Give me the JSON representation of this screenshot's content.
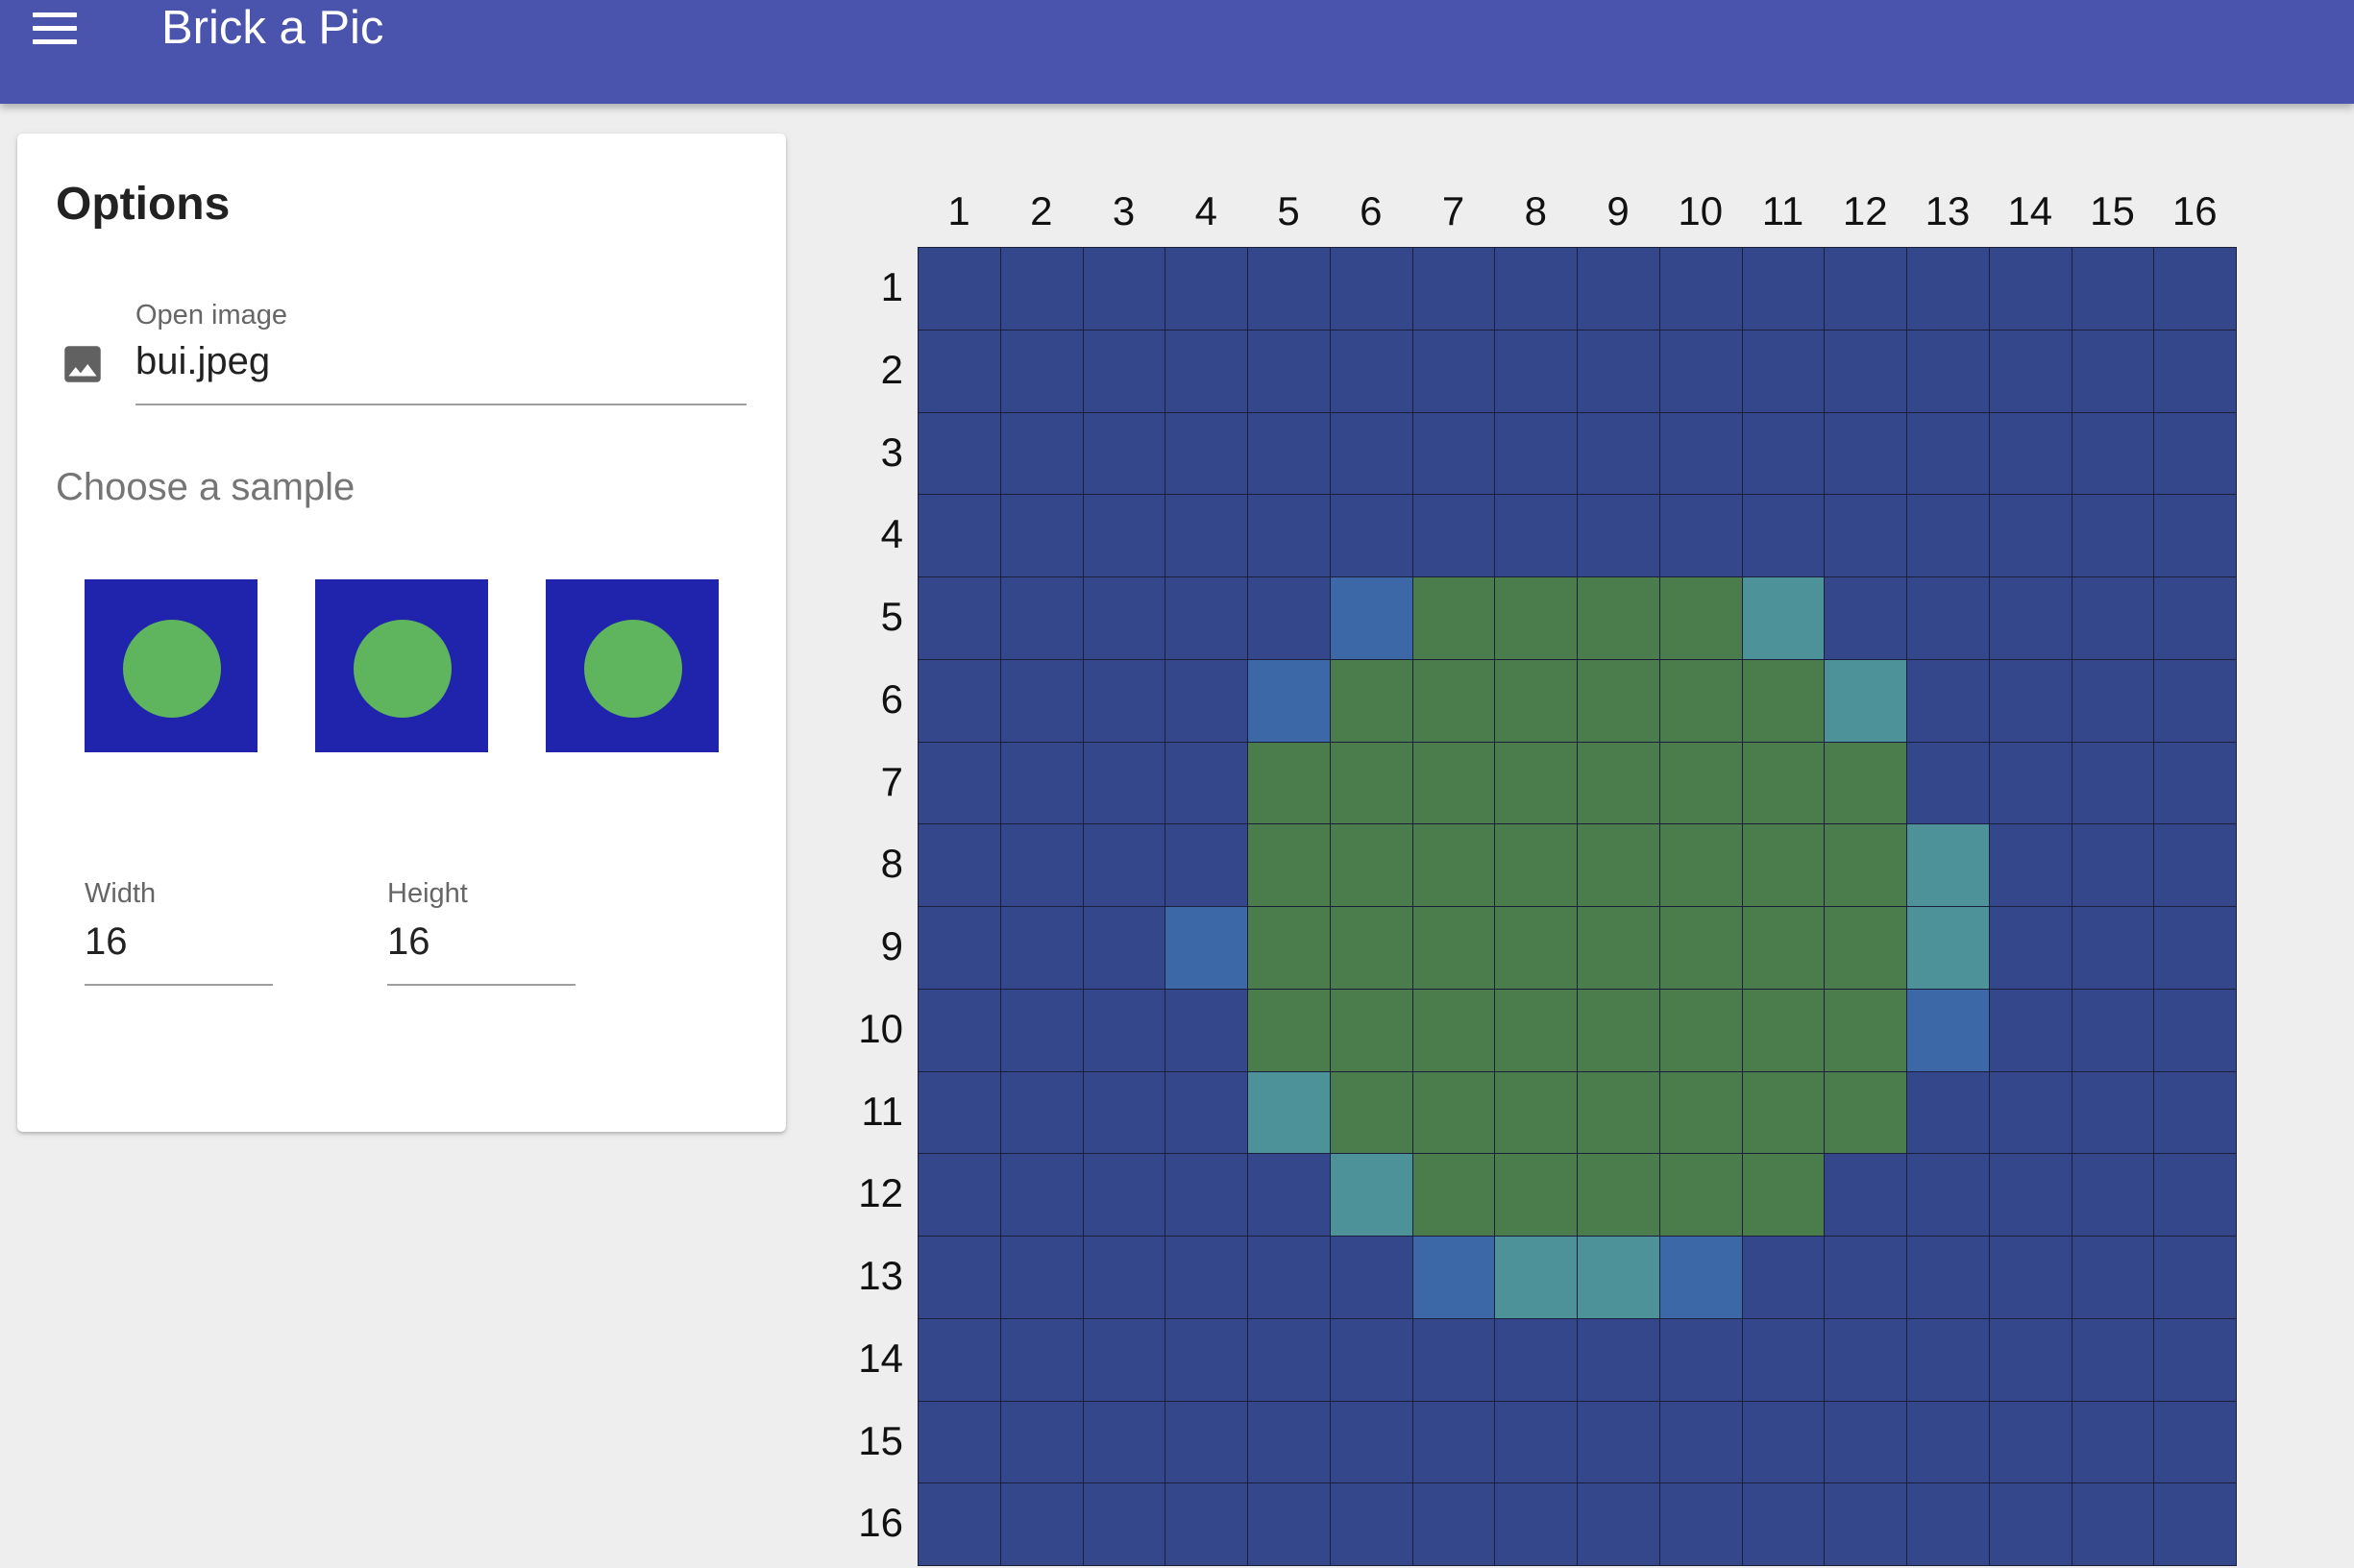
{
  "app": {
    "title": "Brick a Pic"
  },
  "options": {
    "title": "Options",
    "open_image": {
      "label": "Open image",
      "value": "bui.jpeg",
      "icon": "image-icon"
    },
    "samples": {
      "heading": "Choose a sample",
      "count": 3,
      "background_color": "#2024ac",
      "circle_color": "#5fb45e"
    },
    "width": {
      "label": "Width",
      "value": "16"
    },
    "height": {
      "label": "Height",
      "value": "16"
    }
  },
  "colors": {
    "appbar": "#4a54ad",
    "D": "#33478a",
    "G": "#4a7d4b",
    "B": "#3c68a8",
    "T": "#4d9199"
  },
  "grid": {
    "columns": [
      "1",
      "2",
      "3",
      "4",
      "5",
      "6",
      "7",
      "8",
      "9",
      "10",
      "11",
      "12",
      "13",
      "14",
      "15",
      "16"
    ],
    "rows": [
      "1",
      "2",
      "3",
      "4",
      "5",
      "6",
      "7",
      "8",
      "9",
      "10",
      "11",
      "12",
      "13",
      "14",
      "15",
      "16"
    ],
    "cells": [
      "DDDDDDDDDDDDDDDD",
      "DDDDDDDDDDDDDDDD",
      "DDDDDDDDDDDDDDDD",
      "DDDDDDDDDDDDDDDD",
      "DDDDDBGGGGTDDDDD",
      "DDDDBGGGGGGTDDDD",
      "DDDDGGGGGGGGDDDD",
      "DDDDGGGGGGGGTDDD",
      "DDDBGGGGGGGGTDDD",
      "DDDDGGGGGGGGBDDD",
      "DDDDTGGGGGGGDDDD",
      "DDDDDTGGGGGDDDDD",
      "DDDDDDBTTBDDDDDD",
      "DDDDDDDDDDDDDDDD",
      "DDDDDDDDDDDDDDDD",
      "DDDDDDDDDDDDDDDD"
    ]
  }
}
